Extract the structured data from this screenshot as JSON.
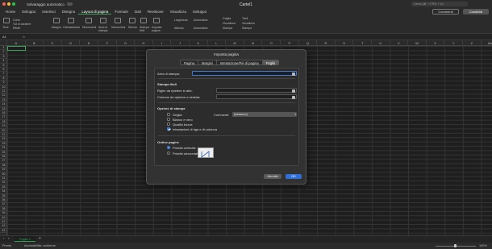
{
  "titlebar": {
    "autosave": "Salvataggio automatico",
    "doc_title": "Cartel1",
    "search_placeholder": "Cerca (⌘ + CTRL + U)"
  },
  "menu": {
    "tabs": [
      "Home",
      "Sviluppo",
      "Inserisci",
      "Disegno",
      "Layout di pagina",
      "Formule",
      "Dati",
      "Revisione",
      "Visualizza",
      "Sviluppo"
    ],
    "active": "Layout di pagina",
    "comments": "Commenti",
    "share": "Condividi"
  },
  "ribbon": {
    "temi": "Temi",
    "colori": "Colori",
    "caratteri": "Tut di caratere",
    "effetti": "Effetti",
    "margini": "Margini",
    "orientamento": "Orientamento",
    "dimensioni": "Dimensioni",
    "area": "Area di stampa",
    "interruzioni": "Interruzioni",
    "sfondo": "Sfondo",
    "stampa_titoli": "Stampa titoli",
    "imposta": "Imposta pagina",
    "larghezza": "Larghezza:",
    "altezza": "Altezza:",
    "automatica1": "Automatica",
    "automatica2": "Automatica",
    "griglia": "Griglia",
    "titoli": "Titoli",
    "visualizza1": "Visualizza",
    "visualizza2": "Visualizza",
    "stampa1": "Stampa",
    "stampa2": "Stampa"
  },
  "formula_bar": {
    "namebox": "A1",
    "fx": "fx"
  },
  "columns": [
    "A",
    "B",
    "C",
    "D",
    "E",
    "F",
    "G",
    "H",
    "I",
    "J",
    "K",
    "L",
    "M",
    "N",
    "O",
    "P",
    "Q",
    "R",
    "S",
    "T",
    "U",
    "V",
    "W",
    "X",
    "Y",
    "Z",
    "AA"
  ],
  "rows": [
    "1",
    "2",
    "3",
    "4",
    "5",
    "6",
    "7",
    "8",
    "9",
    "10",
    "11",
    "12",
    "13",
    "14",
    "15",
    "16",
    "17",
    "18",
    "19",
    "20",
    "21",
    "22",
    "23",
    "24",
    "25",
    "26",
    "27",
    "28",
    "29",
    "30",
    "31",
    "32",
    "33",
    "34",
    "35",
    "36",
    "37",
    "38",
    "39",
    "40",
    "41",
    "42",
    "43"
  ],
  "sheet_tab": "Foglio 1",
  "status": {
    "ready": "Pronto",
    "access": "Accessibilità: conforme",
    "zoom": "100%"
  },
  "dialog": {
    "title": "Imposta pagina",
    "tabs": [
      "Pagina",
      "Margini",
      "Intestazione/Piè di pagina",
      "Foglio"
    ],
    "active_tab": "Foglio",
    "area_label": "Area di stampa:",
    "area_value": "",
    "stampa_titoli": "Stampa titoli",
    "righe_label": "Righe da ripetere in alto:",
    "colonne_label": "Colonne da ripetere a sinistra:",
    "opzioni": "Opzioni di stampa",
    "griglia": "Griglia",
    "bianco_nero": "Bianco e nero",
    "qualita": "Qualità bozza",
    "intestazioni": "Intestazioni di riga e di colonna",
    "commenti_label": "Commenti:",
    "commenti_value": "(nessuno)",
    "ordine": "Ordine pagine",
    "verticale": "Priorità verticale",
    "orizzontale": "Priorità orizzontale",
    "annulla": "Annulla",
    "ok": "OK"
  }
}
